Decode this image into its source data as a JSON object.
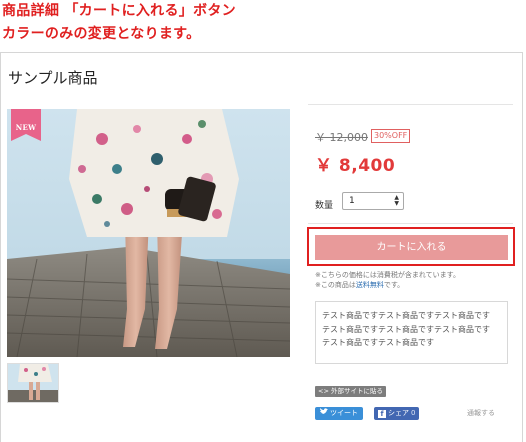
{
  "caption": {
    "line1": "商品詳細 「カートに入れる」ボタン",
    "line2": "カラーのみの変更となります。"
  },
  "product": {
    "title": "サンプル商品",
    "badge": "NEW",
    "old_price": "￥ 12,000",
    "discount": "30%OFF",
    "price": "￥ 8,400",
    "quantity_label": "数量",
    "quantity_value": "1",
    "cart_button": "カートに入れる",
    "note_tax": "※こちらの価格には消費税が含まれています。",
    "note_shipping_prefix": "※この商品は",
    "note_shipping_link": "送料無料",
    "note_shipping_suffix": "です。",
    "description": [
      "テスト商品ですテスト商品ですテスト商品です",
      "テスト商品ですテスト商品ですテスト商品です",
      "テスト商品ですテスト商品です"
    ]
  },
  "social": {
    "embed": "<> 外部サイトに貼る",
    "tweet": "ツイート",
    "share": "シェア",
    "share_count": "0",
    "contact": "通報する"
  },
  "colors": {
    "caption": "#e02020",
    "price": "#e23a3a",
    "cart_button_bg": "#e89a9a",
    "highlight_outline": "#e02020",
    "badge": "#e8638a"
  },
  "icons": {
    "qty": "up-down-arrows-icon",
    "tweet": "bird-icon",
    "share": "facebook-icon"
  }
}
